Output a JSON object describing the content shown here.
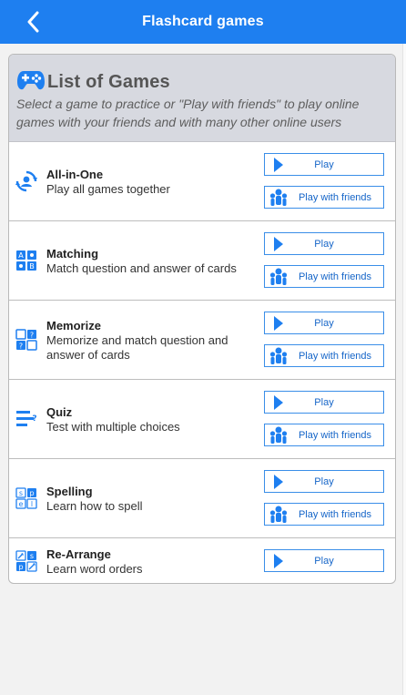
{
  "header": {
    "title": "Flashcard games",
    "back_icon": "chevron-left-icon",
    "background": "#1e7ff0"
  },
  "panel": {
    "title": "List of Games",
    "description": "Select a game to practice or \"Play with friends\" to play online games with your friends and with many other online users",
    "icon": "gamepad-icon"
  },
  "games": [
    {
      "name": "All-in-One",
      "description": "Play all games together",
      "icon": "all-in-one-icon",
      "play_label": "Play",
      "friends_label": "Play with friends"
    },
    {
      "name": "Matching",
      "description": "Match question and answer of cards",
      "icon": "matching-icon",
      "play_label": "Play",
      "friends_label": "Play with friends"
    },
    {
      "name": "Memorize",
      "description": "Memorize and match question and answer of cards",
      "icon": "memorize-icon",
      "play_label": "Play",
      "friends_label": "Play with friends"
    },
    {
      "name": "Quiz",
      "description": "Test with multiple choices",
      "icon": "quiz-icon",
      "play_label": "Play",
      "friends_label": "Play with friends"
    },
    {
      "name": "Spelling",
      "description": "Learn how to spell",
      "icon": "spelling-icon",
      "play_label": "Play",
      "friends_label": "Play with friends"
    },
    {
      "name": "Re-Arrange",
      "description": "Learn word orders",
      "icon": "rearrange-icon",
      "play_label": "Play"
    }
  ],
  "colors": {
    "accent": "#1e7ff0",
    "button_border": "#3a8ee8",
    "button_text": "#1565c8"
  }
}
